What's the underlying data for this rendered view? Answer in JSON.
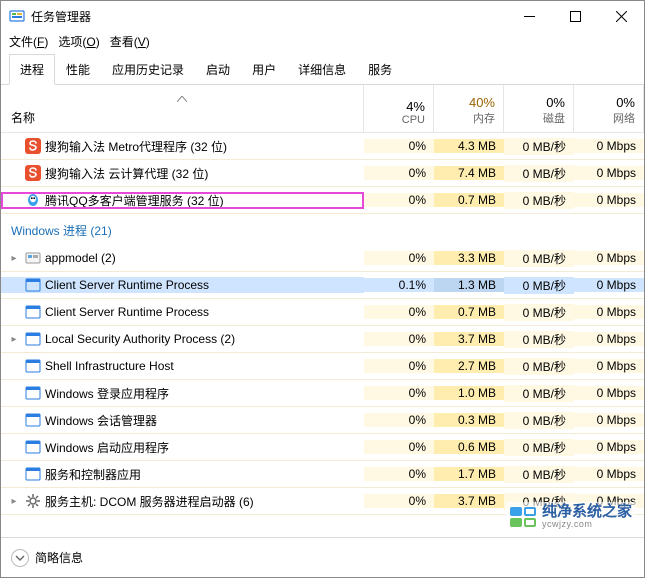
{
  "window": {
    "title": "任务管理器"
  },
  "menu": {
    "file_label": "文件(",
    "file_key": "F",
    "options_label": "选项(",
    "options_key": "O",
    "view_label": "查看(",
    "view_key": "V",
    "close_paren": ")"
  },
  "tabs": {
    "items": [
      {
        "label": "进程",
        "active": true
      },
      {
        "label": "性能",
        "active": false
      },
      {
        "label": "应用历史记录",
        "active": false
      },
      {
        "label": "启动",
        "active": false
      },
      {
        "label": "用户",
        "active": false
      },
      {
        "label": "详细信息",
        "active": false
      },
      {
        "label": "服务",
        "active": false
      }
    ]
  },
  "columns": {
    "name": "名称",
    "cpu": {
      "pct": "4%",
      "label": "CPU"
    },
    "mem": {
      "pct": "40%",
      "label": "内存"
    },
    "disk": {
      "pct": "0%",
      "label": "磁盘"
    },
    "net": {
      "pct": "0%",
      "label": "网络"
    }
  },
  "top_rows": [
    {
      "icon": "sogou",
      "name": "搜狗输入法 Metro代理程序 (32 位)",
      "cpu": "0%",
      "mem": "4.3 MB",
      "disk": "0 MB/秒",
      "net": "0 Mbps"
    },
    {
      "icon": "sogou",
      "name": "搜狗输入法 云计算代理 (32 位)",
      "cpu": "0%",
      "mem": "7.4 MB",
      "disk": "0 MB/秒",
      "net": "0 Mbps"
    },
    {
      "icon": "qq",
      "name": "腾讯QQ多客户端管理服务 (32 位)",
      "cpu": "0%",
      "mem": "0.7 MB",
      "disk": "0 MB/秒",
      "net": "0 Mbps",
      "highlight": true
    }
  ],
  "group": {
    "label": "Windows 进程 (21)"
  },
  "win_rows": [
    {
      "exp": true,
      "icon": "app",
      "name": "appmodel (2)",
      "cpu": "0%",
      "mem": "3.3 MB",
      "disk": "0 MB/秒",
      "net": "0 Mbps"
    },
    {
      "exp": false,
      "icon": "exe",
      "name": "Client Server Runtime Process",
      "cpu": "0.1%",
      "mem": "1.3 MB",
      "disk": "0 MB/秒",
      "net": "0 Mbps",
      "selected": true
    },
    {
      "exp": false,
      "icon": "exe",
      "name": "Client Server Runtime Process",
      "cpu": "0%",
      "mem": "0.7 MB",
      "disk": "0 MB/秒",
      "net": "0 Mbps"
    },
    {
      "exp": true,
      "icon": "exe",
      "name": "Local Security Authority Process (2)",
      "cpu": "0%",
      "mem": "3.7 MB",
      "disk": "0 MB/秒",
      "net": "0 Mbps"
    },
    {
      "exp": false,
      "icon": "exe",
      "name": "Shell Infrastructure Host",
      "cpu": "0%",
      "mem": "2.7 MB",
      "disk": "0 MB/秒",
      "net": "0 Mbps"
    },
    {
      "exp": false,
      "icon": "exe",
      "name": "Windows 登录应用程序",
      "cpu": "0%",
      "mem": "1.0 MB",
      "disk": "0 MB/秒",
      "net": "0 Mbps"
    },
    {
      "exp": false,
      "icon": "exe",
      "name": "Windows 会话管理器",
      "cpu": "0%",
      "mem": "0.3 MB",
      "disk": "0 MB/秒",
      "net": "0 Mbps"
    },
    {
      "exp": false,
      "icon": "exe",
      "name": "Windows 启动应用程序",
      "cpu": "0%",
      "mem": "0.6 MB",
      "disk": "0 MB/秒",
      "net": "0 Mbps"
    },
    {
      "exp": false,
      "icon": "exe",
      "name": "服务和控制器应用",
      "cpu": "0%",
      "mem": "1.7 MB",
      "disk": "0 MB/秒",
      "net": "0 Mbps"
    },
    {
      "exp": true,
      "icon": "gear",
      "name": "服务主机: DCOM 服务器进程启动器 (6)",
      "cpu": "0%",
      "mem": "3.7 MB",
      "disk": "0 MB/秒",
      "net": "0 Mbps"
    }
  ],
  "footer": {
    "label": "简略信息"
  },
  "watermark": {
    "title": "纯净系统之家",
    "sub": "ycwjzy.com"
  }
}
